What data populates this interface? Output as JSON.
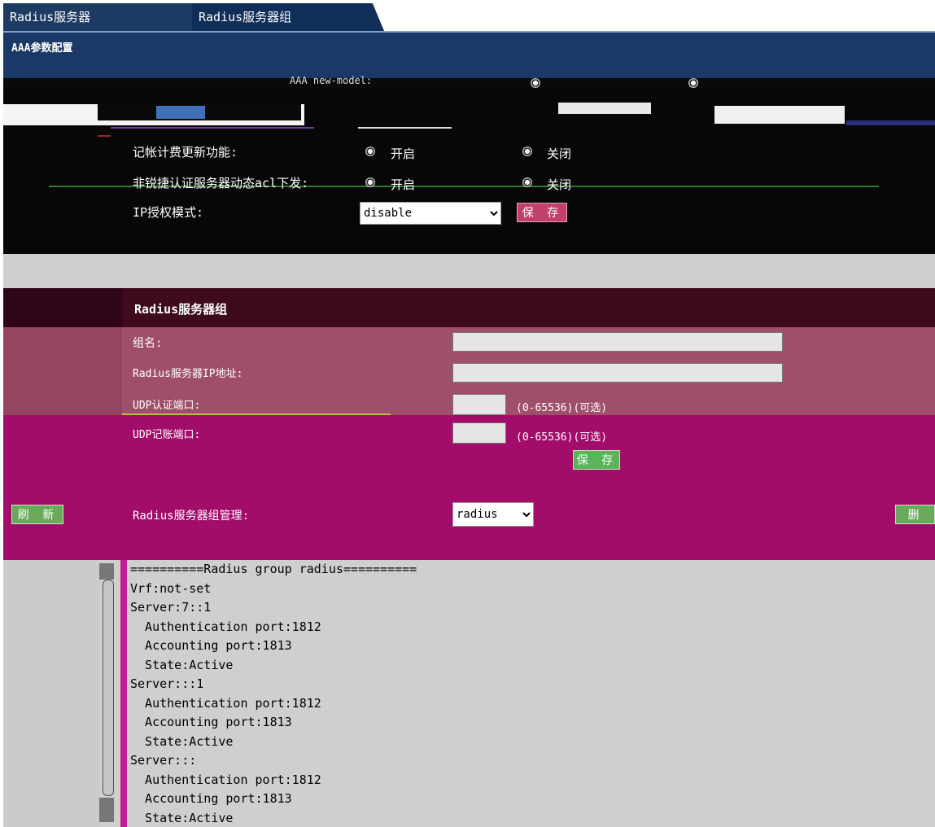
{
  "tabs": [
    {
      "label": "Radius服务器"
    },
    {
      "label": "Radius服务器组"
    }
  ],
  "aaa": {
    "title": "AAA参数配置",
    "new_model_label": "AAA new-model:"
  },
  "settings": {
    "accounting_update_label": "记帐计费更新功能:",
    "acl_label": "非锐捷认证服务器动态acl下发:",
    "on_label": "开启",
    "off_label": "关闭",
    "ip_auth_label": "IP授权模式:",
    "ip_auth_value": "disable",
    "ip_auth_options": [
      "disable"
    ],
    "save_label": "保 存"
  },
  "group": {
    "title": "Radius服务器组",
    "name_label": "组名:",
    "ip_label": "Radius服务器IP地址:",
    "auth_port_label": "UDP认证端口:",
    "acct_port_label": "UDP记账端口:",
    "port_hint": "(0-65536)(可选)",
    "save_label": "保 存",
    "refresh_label": "刷 新",
    "manage_label": "Radius服务器组管理:",
    "manage_value": "radius",
    "manage_options": [
      "radius"
    ],
    "delete_label": "删 除"
  },
  "output": {
    "text": "==========Radius group radius==========\nVrf:not-set\nServer:7::1\n  Authentication port:1812\n  Accounting port:1813\n  State:Active\nServer:::1\n  Authentication port:1812\n  Accounting port:1813\n  State:Active\nServer:::\n  Authentication port:1812\n  Accounting port:1813\n  State:Active"
  },
  "colors": {
    "tab_bg": "#1d3b63",
    "group_header": "#3d0a1e",
    "group_form": "#9f4f6b",
    "magenta": "#a20c6a",
    "save_pink": "#c2406c",
    "button_green": "#5bb35a"
  }
}
